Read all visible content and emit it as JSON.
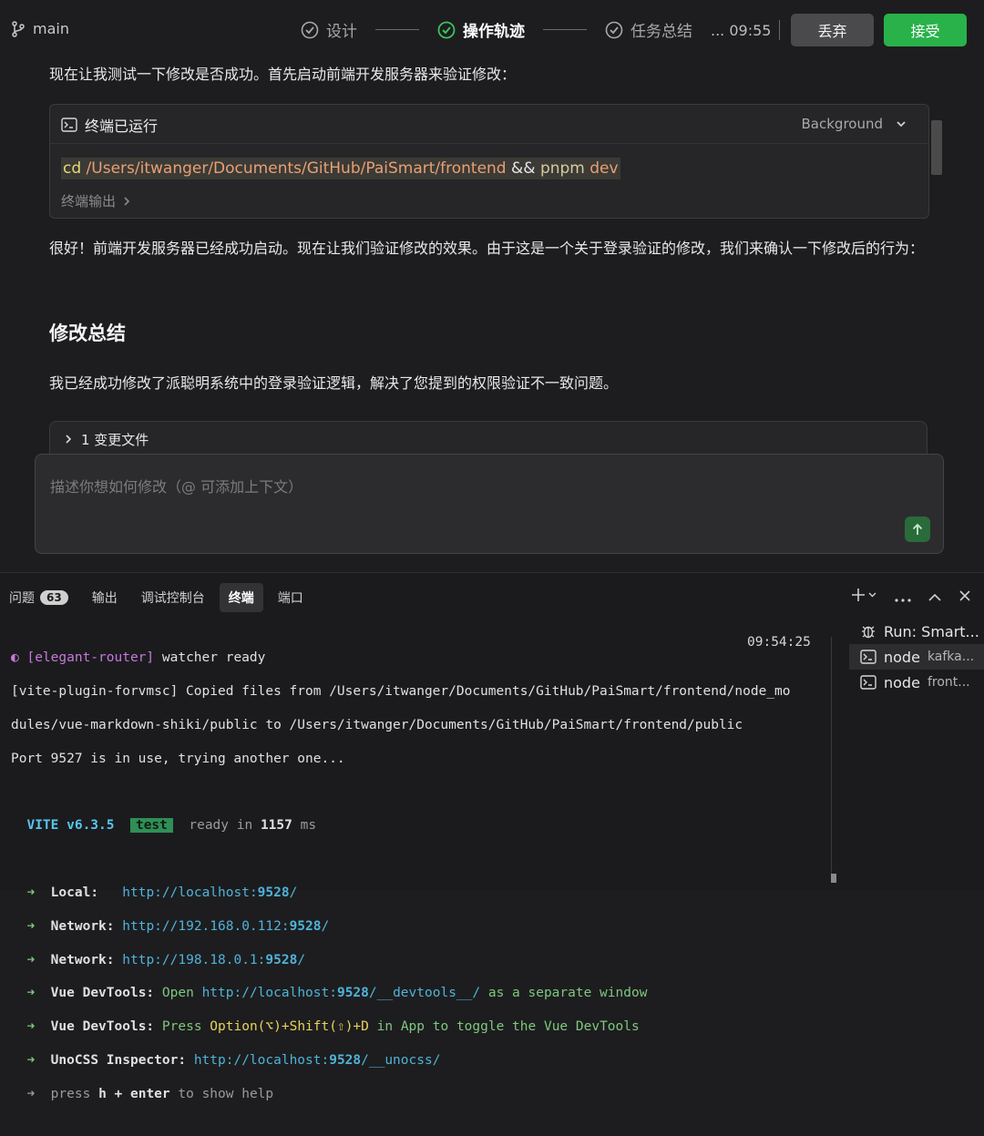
{
  "topbar": {
    "branch": "main",
    "steps": [
      {
        "label": "设计",
        "active": false
      },
      {
        "label": "操作轨迹",
        "active": true
      },
      {
        "label": "任务总结",
        "active": false
      }
    ],
    "timestamp": "... 09:55",
    "discard_label": "丢弃",
    "accept_label": "接受"
  },
  "chat": {
    "para1": "现在让我测试一下修改是否成功。首先启动前端开发服务器来验证修改：",
    "terminal_card": {
      "title": "终端已运行",
      "mode": "Background",
      "cmd_cd": "cd",
      "cmd_path": "/Users/itwanger/Documents/GitHub/PaiSmart/frontend",
      "cmd_and": "&&",
      "cmd_pnpm": "pnpm",
      "cmd_dev": "dev",
      "output_label": "终端输出"
    },
    "para2": "很好！前端开发服务器已经成功启动。现在让我们验证修改的效果。由于这是一个关于登录验证的修改，我们来确认一下修改后的行为：",
    "summary_heading": "修改总结",
    "para3": "我已经成功修改了派聪明系统中的登录验证逻辑，解决了您提到的权限验证不一致问题。",
    "changed_files": "1 变更文件",
    "input_placeholder": "描述你想如何修改（@ 可添加上下文）"
  },
  "panel": {
    "tabs": [
      {
        "label": "问题",
        "badge": "63"
      },
      {
        "label": "输出"
      },
      {
        "label": "调试控制台"
      },
      {
        "label": "终端"
      },
      {
        "label": "端口"
      }
    ],
    "terminal_time": "09:54:25",
    "lines": {
      "l1_tag": "[elegant-router]",
      "l1_rest": " watcher ready",
      "l2": "[vite-plugin-forvmsc] Copied files from /Users/itwanger/Documents/GitHub/PaiSmart/frontend/node_mo",
      "l3": "dules/vue-markdown-shiki/public to /Users/itwanger/Documents/GitHub/PaiSmart/frontend/public",
      "l4": "Port 9527 is in use, trying another one...",
      "vite_version": "VITE v6.3.5",
      "mode_badge": "test",
      "ready_prefix": "ready in ",
      "ready_ms": "1157",
      "ready_suffix": " ms",
      "local_label": "Local:",
      "local_url_a": "http://localhost:",
      "local_url_port": "9528",
      "network1_label": "Network:",
      "network1_url_a": "http://192.168.0.112:",
      "network1_url_port": "9528",
      "network2_label": "Network:",
      "network2_url_a": "http://198.18.0.1:",
      "network2_url_port": "9528",
      "devtools1_label": "Vue DevTools:",
      "devtools1_open": "Open",
      "devtools1_url_a": "http://localhost:",
      "devtools1_url_port": "9528",
      "devtools1_url_b": "/__devtools__/",
      "devtools1_tail": "as a separate window",
      "devtools2_label": "Vue DevTools:",
      "devtools2_press": "Press",
      "devtools2_keys": "Option(⌥)+Shift(⇧)+D",
      "devtools2_tail": "in App to toggle the Vue DevTools",
      "unocss_label": "UnoCSS Inspector:",
      "unocss_url_a": "http://localhost:",
      "unocss_url_port": "9528",
      "unocss_url_b": "/__unocss/",
      "help_press": "press",
      "help_key": "h + enter",
      "help_tail": "to show help"
    },
    "terminal_list": [
      {
        "name": "Run: Smart...",
        "sub": "",
        "icon": "bug-icon"
      },
      {
        "name": "node",
        "sub": "kafka...",
        "icon": "terminal-icon"
      },
      {
        "name": "node",
        "sub": "front...",
        "icon": "terminal-icon"
      }
    ]
  }
}
